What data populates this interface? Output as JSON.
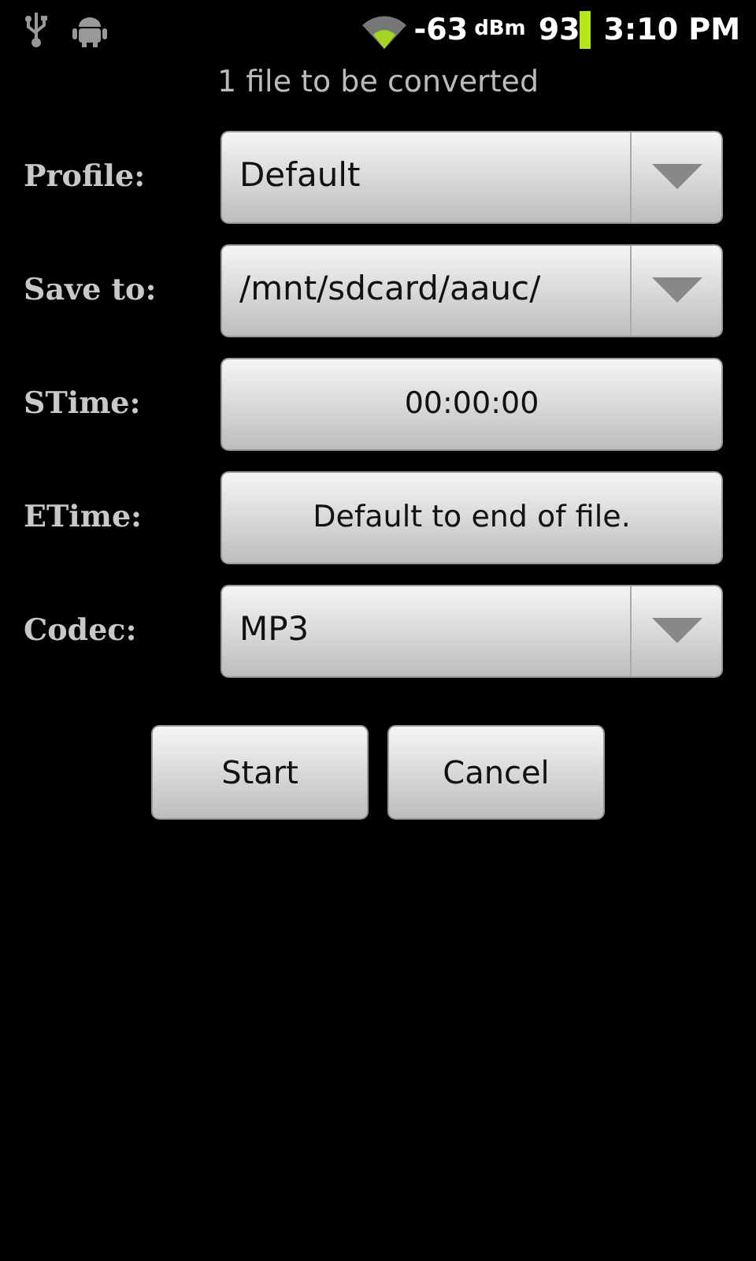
{
  "status_bar": {
    "signal": "-63",
    "signal_unit": "dBm",
    "battery": "93",
    "time": "3:10 PM"
  },
  "header": "1  file to be converted",
  "fields": [
    {
      "label": "Profile:",
      "kind": "spinner",
      "value": "Default"
    },
    {
      "label": "Save to:",
      "kind": "spinner",
      "value": "/mnt/sdcard/aauc/"
    },
    {
      "label": "STime:",
      "kind": "button",
      "value": "00:00:00"
    },
    {
      "label": "ETime:",
      "kind": "button",
      "value": "Default to end of file."
    },
    {
      "label": "Codec:",
      "kind": "spinner",
      "value": "MP3"
    }
  ],
  "buttons": [
    "Start",
    "Cancel"
  ]
}
